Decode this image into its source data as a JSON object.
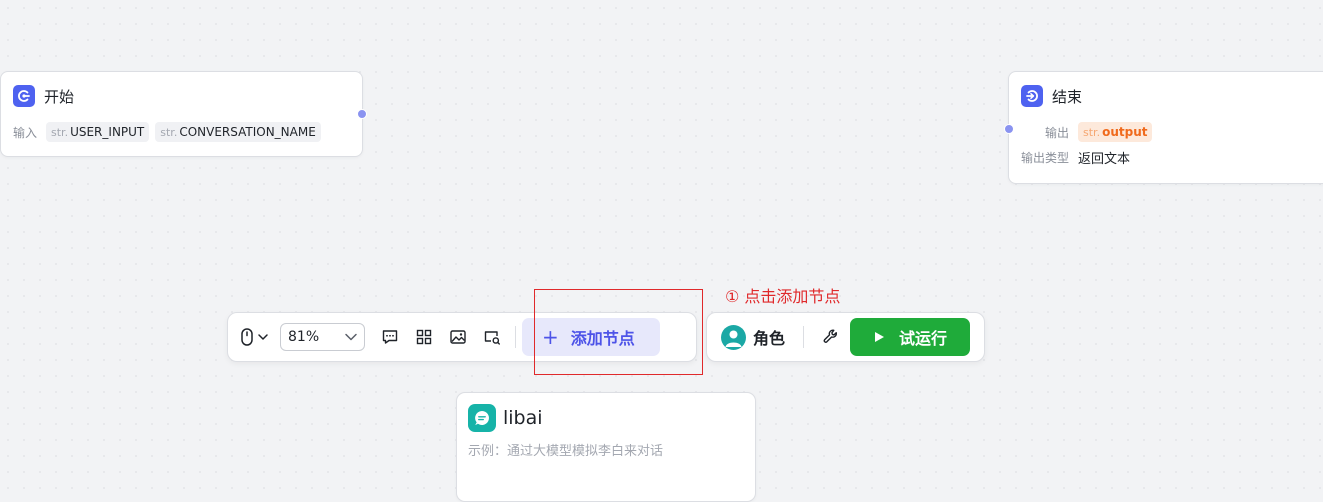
{
  "start_node": {
    "title": "开始",
    "input_label": "输入",
    "inputs": [
      {
        "type": "str.",
        "name": "USER_INPUT"
      },
      {
        "type": "str.",
        "name": "CONVERSATION_NAME"
      }
    ]
  },
  "end_node": {
    "title": "结束",
    "output_label": "输出",
    "output": {
      "type": "str.",
      "name": "output"
    },
    "output_type_label": "输出类型",
    "output_type_value": "返回文本"
  },
  "toolbar": {
    "zoom": "81%",
    "add_node_label": "添加节点",
    "role_label": "角色",
    "run_label": "试运行"
  },
  "annotation": "① 点击添加节点",
  "libai_node": {
    "title": "libai",
    "description": "示例：通过大模型模拟李白来对话"
  },
  "colors": {
    "accent": "#4d53e8",
    "run_green": "#1fab3a",
    "annotation_red": "#e0292b"
  }
}
